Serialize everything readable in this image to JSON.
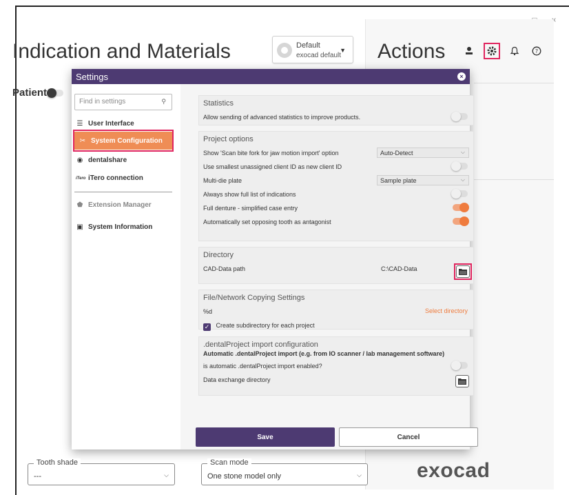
{
  "window": {
    "minimize": "–",
    "maximize": "□",
    "close": "×"
  },
  "main": {
    "title": "Indication and Materials",
    "profile": {
      "line1": "Default",
      "line2": "exocad default"
    },
    "patient_label": "Patient"
  },
  "actions": {
    "title": "Actions"
  },
  "settings": {
    "title": "Settings",
    "search_placeholder": "Find in settings",
    "nav": [
      {
        "label": "User Interface"
      },
      {
        "label": "System Configuration"
      },
      {
        "label": "dentalshare"
      },
      {
        "label": "iTero connection",
        "prefix": "iTero"
      },
      {
        "label": "Extension Manager"
      },
      {
        "label": "System Information"
      }
    ],
    "statistics": {
      "title": "Statistics",
      "allow_label": "Allow sending of advanced statistics to improve products."
    },
    "project_options": {
      "title": "Project options",
      "scan_bite_label": "Show 'Scan bite fork for jaw motion import' option",
      "scan_bite_value": "Auto-Detect",
      "smallest_id_label": "Use smallest unassigned client ID as new client ID",
      "multi_die_label": "Multi-die plate",
      "multi_die_value": "Sample plate",
      "full_list_label": "Always show full list of indications",
      "full_denture_label": "Full denture - simplified case entry",
      "opposing_label": "Automatically set opposing tooth as antagonist"
    },
    "directory": {
      "title": "Directory",
      "cad_label": "CAD-Data path",
      "cad_value": "C:\\CAD-Data"
    },
    "file_copy": {
      "title": "File/Network Copying Settings",
      "pattern": "%d",
      "select_dir": "Select directory",
      "subdir_label": "Create subdirectory for each project"
    },
    "dental_project": {
      "title": ".dentalProject import configuration",
      "subtitle": "Automatic .dentalProject import (e.g. from IO scanner / lab management software)",
      "enabled_label": "is automatic .dentalProject import enabled?",
      "exchange_label": "Data exchange directory"
    },
    "save_label": "Save",
    "cancel_label": "Cancel"
  },
  "bottom": {
    "tooth_shade_label": "Tooth shade",
    "tooth_shade_value": "---",
    "scan_mode_label": "Scan mode",
    "scan_mode_value": "One stone model only",
    "brand": "exocad"
  },
  "colors": {
    "purple": "#4d3a72",
    "orange": "#ef8d55",
    "highlight": "#e0245e"
  }
}
